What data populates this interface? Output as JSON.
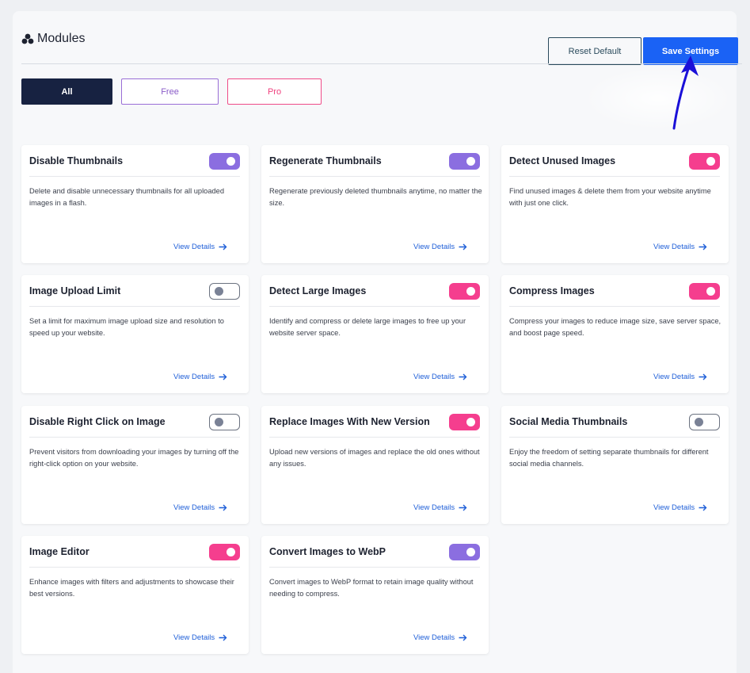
{
  "header": {
    "title": "Modules",
    "title_icon": "modules-icon",
    "reset_label": "Reset Default",
    "save_label": "Save Settings"
  },
  "filters": [
    {
      "label": "All",
      "active": true
    },
    {
      "label": "Free",
      "active": false
    },
    {
      "label": "Pro",
      "active": false
    }
  ],
  "colors": {
    "free_toggle": "#8b6ee0",
    "pro_toggle": "#f53e8e",
    "save_button": "#1a62f5",
    "all_filter": "#172241"
  },
  "modules": [
    {
      "title": "Disable Thumbnails",
      "desc": "Delete and disable unnecessary thumbnails for all uploaded images in a flash.",
      "link": "View Details",
      "enabled": true,
      "tier": "free"
    },
    {
      "title": "Regenerate Thumbnails",
      "desc": "Regenerate previously deleted thumbnails anytime, no matter the size.",
      "link": "View Details",
      "enabled": true,
      "tier": "free"
    },
    {
      "title": "Detect Unused Images",
      "desc": "Find unused images & delete them from your website anytime with just one click.",
      "link": "View Details",
      "enabled": true,
      "tier": "pro"
    },
    {
      "title": "Image Upload Limit",
      "desc": "Set a limit for maximum image upload size and resolution to speed up your website.",
      "link": "View Details",
      "enabled": false,
      "tier": "free"
    },
    {
      "title": "Detect Large Images",
      "desc": "Identify and compress or delete large images to free up your website server space.",
      "link": "View Details",
      "enabled": true,
      "tier": "pro"
    },
    {
      "title": "Compress Images",
      "desc": "Compress your images to reduce image size, save server space, and boost page speed.",
      "link": "View Details",
      "enabled": true,
      "tier": "pro"
    },
    {
      "title": "Disable Right Click on Image",
      "desc": "Prevent visitors from downloading your images by turning off the right-click option on your website.",
      "link": "View Details",
      "enabled": false,
      "tier": "free"
    },
    {
      "title": "Replace Images With New Version",
      "desc": "Upload new versions of images and replace the old ones without any issues.",
      "link": "View Details",
      "enabled": true,
      "tier": "pro"
    },
    {
      "title": "Social Media Thumbnails",
      "desc": "Enjoy the freedom of setting separate thumbnails for different social media channels.",
      "link": "View Details",
      "enabled": false,
      "tier": "pro"
    },
    {
      "title": "Image Editor",
      "desc": "Enhance images with filters and adjustments to showcase their best versions.",
      "link": "View Details",
      "enabled": true,
      "tier": "pro"
    },
    {
      "title": "Convert Images to WebP",
      "desc": "Convert images to WebP format to retain image quality without needing to compress.",
      "link": "View Details",
      "enabled": true,
      "tier": "free"
    }
  ]
}
